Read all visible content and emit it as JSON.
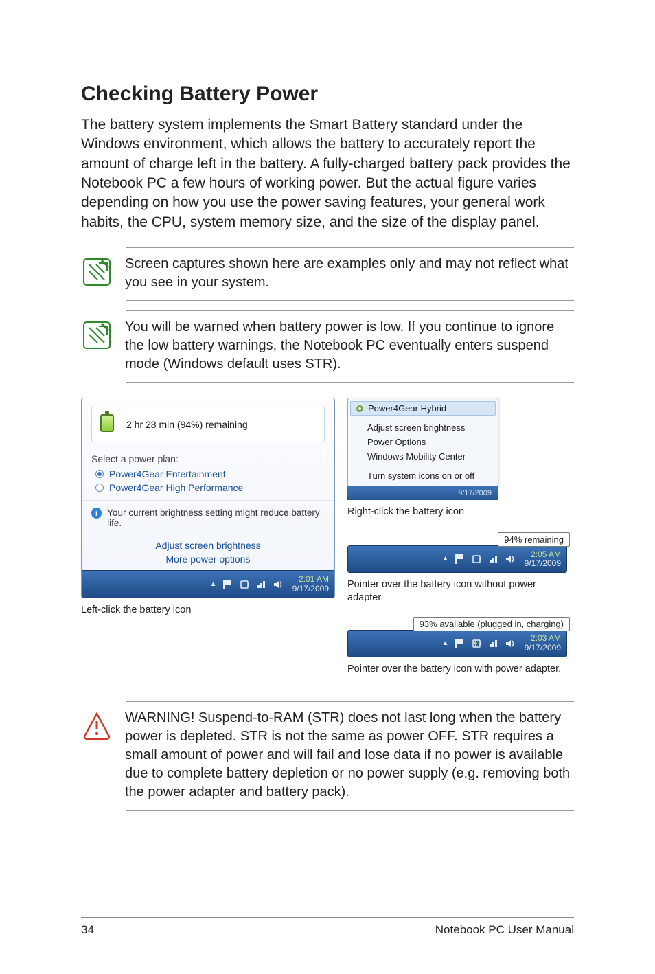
{
  "heading": "Checking Battery Power",
  "intro": "The battery system implements the Smart Battery standard under the Windows environment, which allows the battery to accurately report the amount of charge left in the battery. A fully-charged battery pack provides the Notebook PC a few hours of working power. But the actual figure varies depending on how you use the power saving features, your general work habits, the CPU, system memory size, and the size of the display panel.",
  "note1": "Screen captures shown here are examples only and may not reflect what you see in your system.",
  "note2": "You will be warned when battery power is low. If you continue to ignore the low battery warnings, the Notebook PC eventually enters suspend mode (Windows default uses STR).",
  "popup": {
    "remaining": "2 hr 28 min (94%) remaining",
    "select_plan": "Select a power plan:",
    "plan1": "Power4Gear Entertainment",
    "plan2": "Power4Gear High Performance",
    "brightness_msg": "Your current brightness setting might reduce battery life.",
    "link_adjust": "Adjust screen brightness",
    "link_more": "More power options",
    "time": "2:01 AM",
    "date": "9/17/2009"
  },
  "ctx": {
    "item1": "Power4Gear Hybrid",
    "item2": "Adjust screen brightness",
    "item3": "Power Options",
    "item4": "Windows Mobility Center",
    "item5": "Turn system icons on or off",
    "date": "9/17/2009"
  },
  "caption_left": "Left-click the battery icon",
  "caption_rightclick": "Right-click the battery icon",
  "tooltip1": "94% remaining",
  "tooltip1_time": "2:05 AM",
  "tooltip1_date": "9/17/2009",
  "caption_pointer_nopower": "Pointer over the battery icon without power adapter.",
  "tooltip2": "93% available (plugged in, charging)",
  "tooltip2_time": "2:03 AM",
  "tooltip2_date": "9/17/2009",
  "caption_pointer_power": "Pointer over the battery icon with power adapter.",
  "warning": "WARNING!  Suspend-to-RAM (STR) does not last long when the battery power is depleted. STR is not the same as power OFF. STR requires a small amount of power and will fail and lose data if no power is available due to complete battery depletion or no power supply (e.g. removing both the power adapter and battery pack).",
  "footer_page": "34",
  "footer_text": "Notebook PC User Manual"
}
